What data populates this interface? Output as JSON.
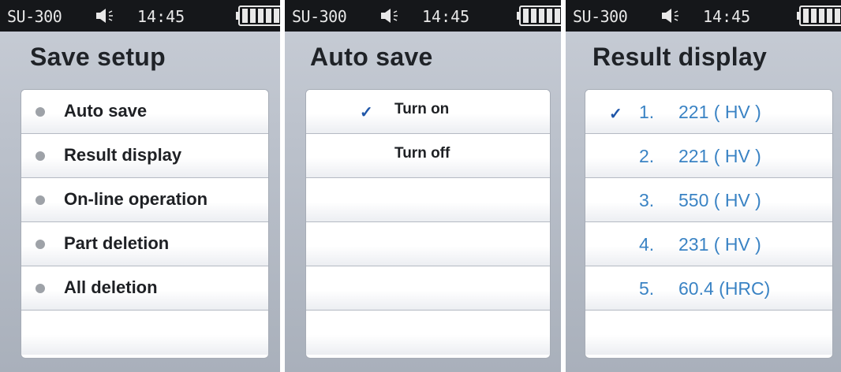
{
  "status_bar": {
    "model": "SU-300",
    "time": "14:45",
    "speaker_icon": "speaker-volume-icon",
    "battery_icon": "battery-full-icon"
  },
  "screens": [
    {
      "title": "Save setup",
      "items": [
        "Auto save",
        "Result display",
        "On-line operation",
        "Part deletion",
        "All deletion",
        ""
      ]
    },
    {
      "title": "Auto save",
      "check_mark": "✓",
      "selected_index": 0,
      "options": [
        "Turn on",
        "Turn off",
        "",
        "",
        "",
        ""
      ]
    },
    {
      "title": "Result display",
      "check_mark": "✓",
      "selected_index": 0,
      "results": [
        {
          "number": "1.",
          "value": "221 ( HV )"
        },
        {
          "number": "2.",
          "value": "221 ( HV )"
        },
        {
          "number": "3.",
          "value": "550 ( HV )"
        },
        {
          "number": "4.",
          "value": "231 ( HV )"
        },
        {
          "number": "5.",
          "value": "60.4 (HRC)"
        },
        {
          "number": "",
          "value": ""
        }
      ]
    }
  ],
  "colors": {
    "status_bar": "#15171a",
    "screen_background": "#bcc2cc",
    "accent_check": "#1f56a8",
    "result_text": "#3a83c4"
  }
}
